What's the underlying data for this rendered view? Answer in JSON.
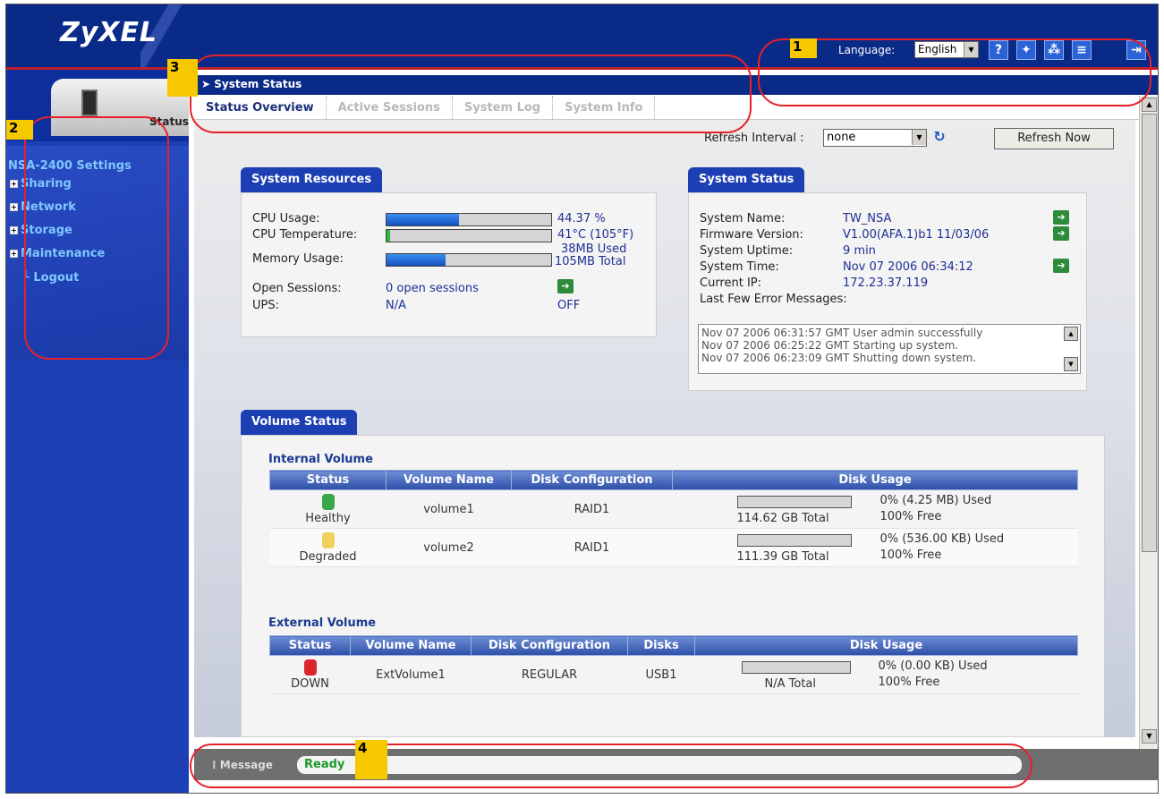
{
  "header": {
    "logo": "ZyXEL",
    "language_label": "Language:",
    "language_value": "English",
    "icons": [
      "help-icon",
      "wizard-icon",
      "network-map-icon",
      "notes-icon",
      "logout-icon"
    ]
  },
  "subbar": {
    "title": "System Status"
  },
  "tabs": [
    {
      "label": "Status Overview",
      "active": true
    },
    {
      "label": "Active Sessions",
      "active": false
    },
    {
      "label": "System Log",
      "active": false
    },
    {
      "label": "System Info",
      "active": false
    }
  ],
  "sidebar": {
    "status_label": "Status",
    "root": "NSA-2400 Settings",
    "items": [
      "Sharing",
      "Network",
      "Storage",
      "Maintenance",
      "Logout"
    ]
  },
  "refresh": {
    "label": "Refresh Interval :",
    "value": "none",
    "button": "Refresh Now"
  },
  "resources": {
    "title": "System Resources",
    "cpu_usage_label": "CPU Usage:",
    "cpu_usage_value": "44.37 %",
    "cpu_usage_fraction": 0.44,
    "cpu_temp_label": "CPU Temperature:",
    "cpu_temp_value": "41°C (105°F)",
    "cpu_temp_fraction": 0.02,
    "memory_label": "Memory Usage:",
    "memory_used": "38MB Used",
    "memory_total": "105MB Total",
    "memory_fraction": 0.36,
    "sessions_label": "Open Sessions:",
    "sessions_value": "0 open sessions",
    "ups_label": "UPS:",
    "ups_value": "N/A",
    "ups_state": "OFF"
  },
  "status": {
    "title": "System Status",
    "name_label": "System Name:",
    "name_value": "TW_NSA",
    "firmware_label": "Firmware Version:",
    "firmware_value": "V1.00(AFA.1)b1 11/03/06",
    "uptime_label": "System Uptime:",
    "uptime_value": "9 min",
    "time_label": "System Time:",
    "time_value": "Nov 07 2006 06:34:12",
    "ip_label": "Current IP:",
    "ip_value": "172.23.37.119",
    "errors_label": "Last Few Error Messages:",
    "errors": [
      "Nov 07 2006 06:31:57 GMT User admin successfully",
      "Nov 07 2006 06:25:22 GMT Starting up system.",
      "Nov 07 2006 06:23:09 GMT Shutting down system."
    ]
  },
  "volume": {
    "title": "Volume Status",
    "internal_title": "Internal Volume",
    "internal_headers": [
      "Status",
      "Volume Name",
      "Disk Configuration",
      "Disk Usage"
    ],
    "internal_rows": [
      {
        "status": "Healthy",
        "color": "#3aa84a",
        "name": "volume1",
        "config": "RAID1",
        "total": "114.62 GB Total",
        "used": "0% (4.25 MB) Used",
        "free": "100% Free"
      },
      {
        "status": "Degraded",
        "color": "#f0d25a",
        "name": "volume2",
        "config": "RAID1",
        "total": "111.39 GB Total",
        "used": "0% (536.00 KB) Used",
        "free": "100% Free"
      }
    ],
    "external_title": "External Volume",
    "external_headers": [
      "Status",
      "Volume Name",
      "Disk Configuration",
      "Disks",
      "Disk Usage"
    ],
    "external_rows": [
      {
        "status": "DOWN",
        "color": "#d8262c",
        "name": "ExtVolume1",
        "config": "REGULAR",
        "disks": "USB1",
        "total": "N/A Total",
        "used": "0% (0.00 KB) Used",
        "free": "100% Free"
      }
    ]
  },
  "message": {
    "label": "Message",
    "value": "Ready"
  },
  "callouts": [
    "1",
    "2",
    "3",
    "4"
  ],
  "colors": {
    "brand": "#0a2a88",
    "sidebar": "#1d3fb4",
    "callout_ring": "#e8202a",
    "callout_badge": "#f5c800",
    "ready": "#1e9a28"
  }
}
